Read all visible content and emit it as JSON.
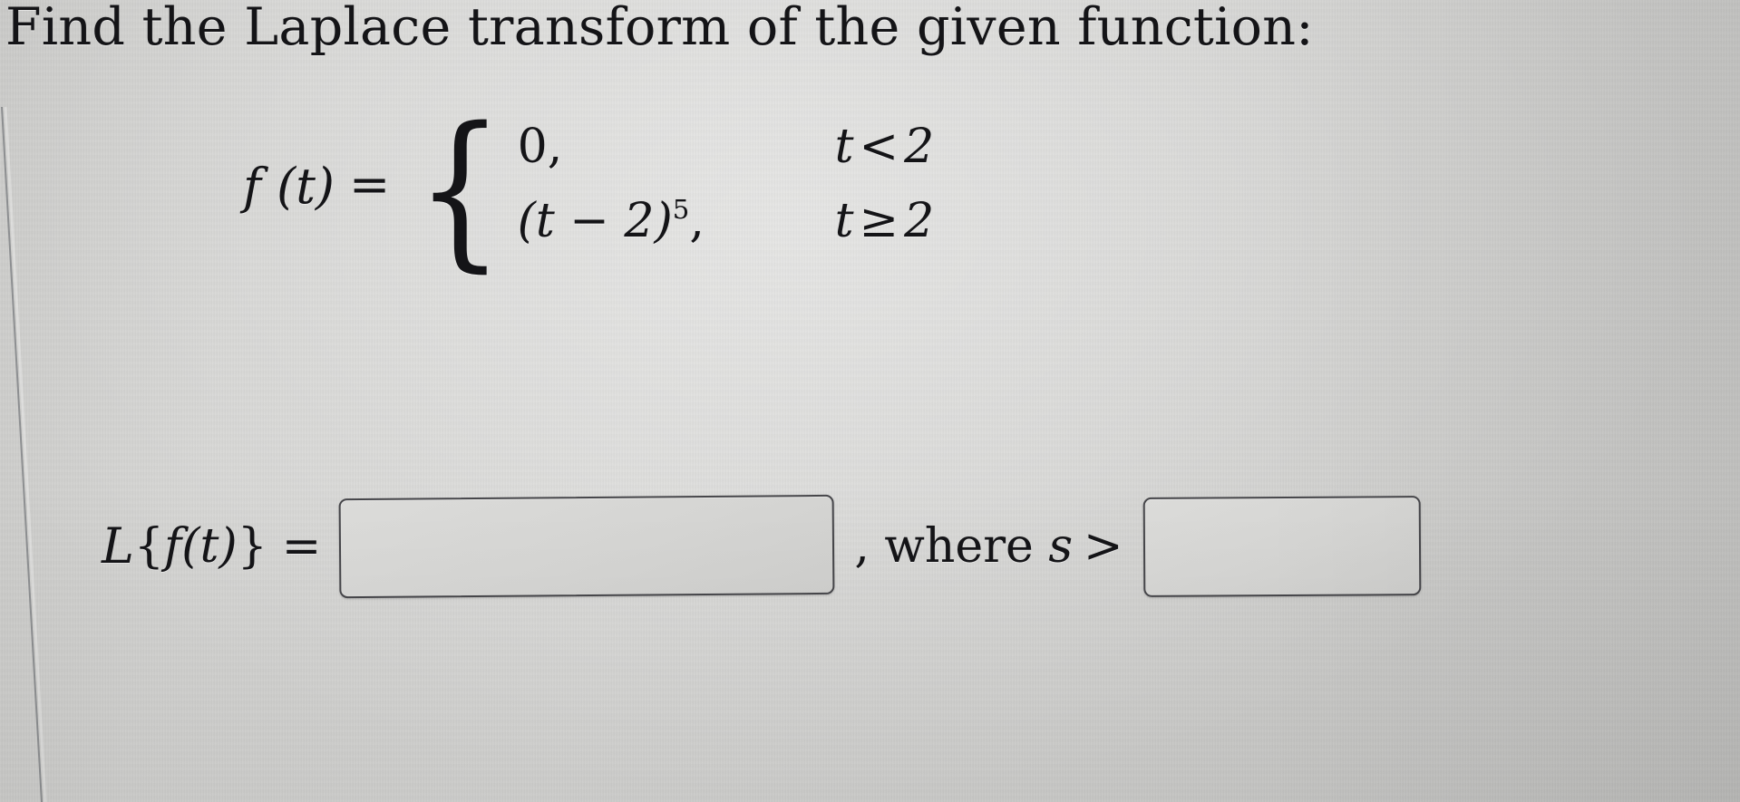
{
  "problem": {
    "prompt": "Find the Laplace transform of the given function:"
  },
  "function_definition": {
    "lhs": "f (t)",
    "equals": "=",
    "brace": "{",
    "cases": [
      {
        "value_prefix": "0",
        "value_exponent": "",
        "value_suffix": ",",
        "variable": "t",
        "relation": "<",
        "bound": "2"
      },
      {
        "value_prefix": "(t − 2)",
        "value_exponent": "5",
        "value_suffix": ",",
        "variable": "t",
        "relation": "≥",
        "bound": "2"
      }
    ]
  },
  "answer": {
    "operator": "L",
    "argument_open": "{",
    "argument_fn": "f",
    "argument_var": "(t)",
    "argument_close": "}",
    "equals": "=",
    "input_1_value": "",
    "input_1_placeholder": "",
    "separator": ", ",
    "where_word": "where",
    "where_variable": "s",
    "where_relation": ">",
    "input_2_value": "",
    "input_2_placeholder": ""
  },
  "colors": {
    "background": "#d2d2d0",
    "text": "#141417",
    "box_border": "#46464a",
    "box_fill": "#d6d6d4"
  }
}
